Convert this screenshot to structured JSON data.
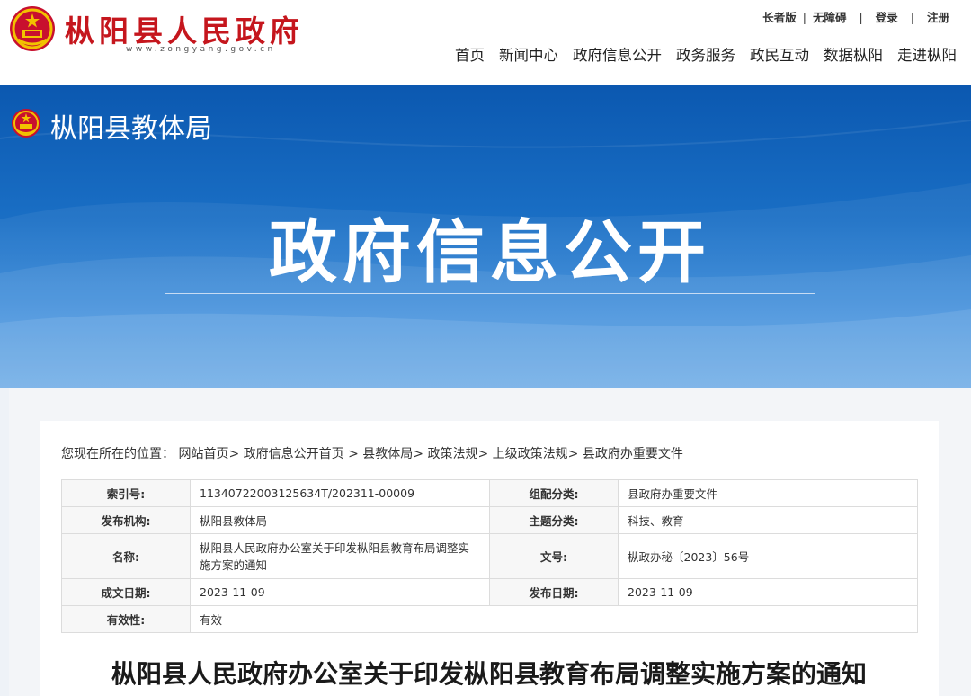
{
  "header": {
    "site_title": "枞阳县人民政府",
    "site_url": "www.zongyang.gov.cn",
    "top_links": {
      "elder": "长者版",
      "accessible": "无障碍",
      "login": "登录",
      "register": "注册"
    },
    "nav": [
      "首页",
      "新闻中心",
      "政府信息公开",
      "政务服务",
      "政民互动",
      "数据枞阳",
      "走进枞阳"
    ]
  },
  "banner": {
    "dept_name": "枞阳县教体局",
    "title": "政府信息公开"
  },
  "breadcrumb": {
    "prefix": "您现在所在的位置：",
    "items": [
      "网站首页",
      "政府信息公开首页",
      "县教体局",
      "政策法规",
      "上级政策法规",
      "县政府办重要文件"
    ]
  },
  "meta": {
    "index_no": {
      "label": "索引号:",
      "value": "11340722003125634T/202311-00009"
    },
    "category": {
      "label": "组配分类:",
      "value": "县政府办重要文件"
    },
    "publisher": {
      "label": "发布机构:",
      "value": "枞阳县教体局"
    },
    "topic": {
      "label": "主题分类:",
      "value": "科技、教育"
    },
    "name": {
      "label": "名称:",
      "value": "枞阳县人民政府办公室关于印发枞阳县教育布局调整实施方案的通知"
    },
    "doc_no": {
      "label": "文号:",
      "value": "枞政办秘〔2023〕56号"
    },
    "created": {
      "label": "成文日期:",
      "value": "2023-11-09"
    },
    "published": {
      "label": "发布日期:",
      "value": "2023-11-09"
    },
    "validity": {
      "label": "有效性:",
      "value": "有效"
    }
  },
  "document": {
    "title": "枞阳县人民政府办公室关于印发枞阳县教育布局调整实施方案的通知"
  },
  "colors": {
    "brand_red": "#c5161d",
    "banner_blue": "#1a6fc5"
  }
}
